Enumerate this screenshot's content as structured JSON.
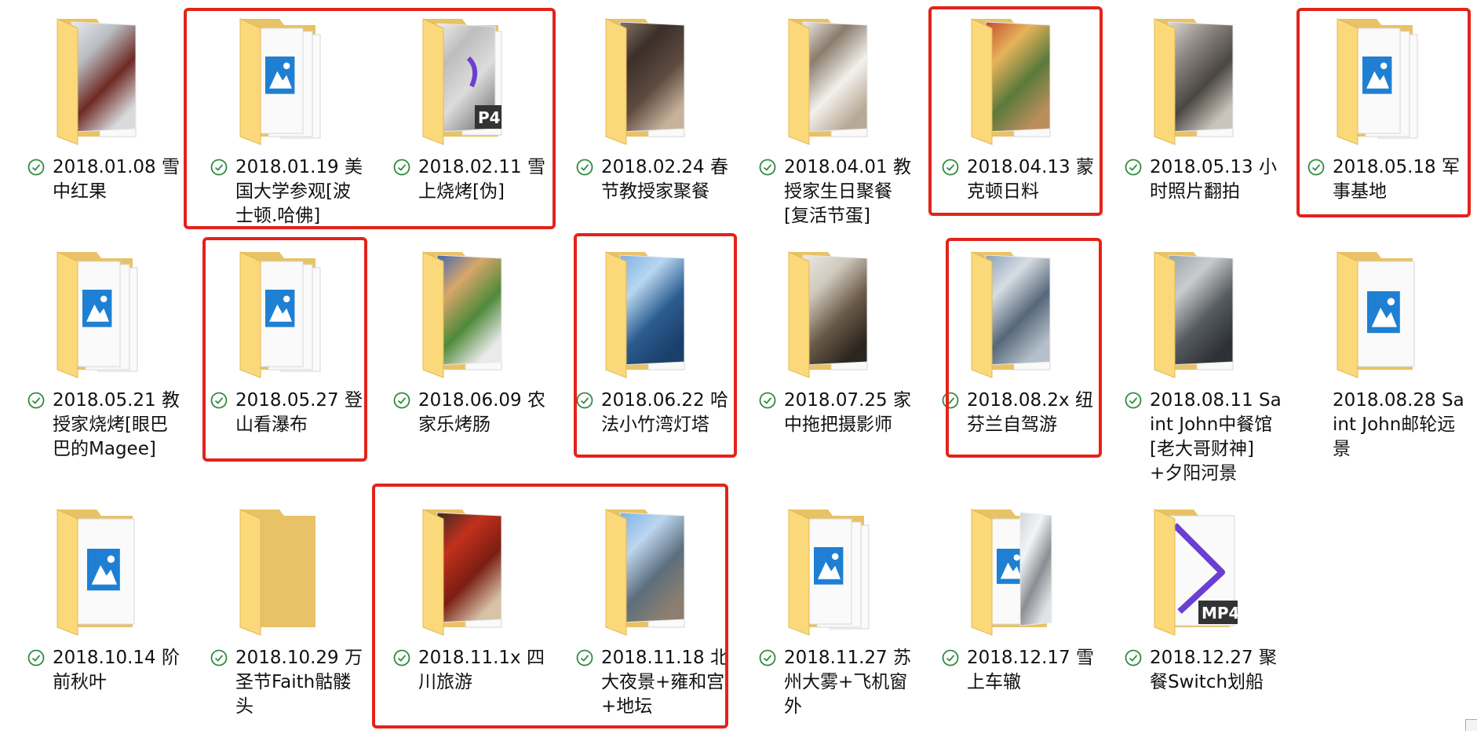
{
  "colors": {
    "folder_back": "#e8c266",
    "folder_front": "#fbd97b",
    "folder_edge": "#e2b955",
    "sync_check": "#2f8a3e",
    "highlight": "#e3231b",
    "placeholder_blue": "#1e7fd3"
  },
  "folders": [
    {
      "name": "2018.01.08 雪中红果",
      "preview": "snow-tree-photo",
      "synced": true
    },
    {
      "name": "2018.01.19 美国大学参观[波士顿.哈佛]",
      "preview": "image-placeholder-stack",
      "synced": true
    },
    {
      "name": "2018.02.11 雪上烧烤[伪]",
      "preview": "photo-with-mp4-badge",
      "synced": true
    },
    {
      "name": "2018.02.24 春节教授家聚餐",
      "preview": "group-photo",
      "synced": true
    },
    {
      "name": "2018.04.01 教授家生日聚餐[复活节蛋]",
      "preview": "photo-prints",
      "synced": true
    },
    {
      "name": "2018.04.13 蒙克顿日料",
      "preview": "sushi-photo",
      "synced": true
    },
    {
      "name": "2018.05.13 小时照片翻拍",
      "preview": "old-photo",
      "synced": true
    },
    {
      "name": "2018.05.18 军事基地",
      "preview": "image-placeholder-stack",
      "synced": true
    },
    {
      "name": "2018.05.21 教授家烧烤[眼巴巴的Magee]",
      "preview": "image-placeholder-stack",
      "synced": true
    },
    {
      "name": "2018.05.27 登山看瀑布",
      "preview": "image-placeholder-stack",
      "synced": true
    },
    {
      "name": "2018.06.09 农家乐烤肠",
      "preview": "food-plate-photo",
      "synced": true
    },
    {
      "name": "2018.06.22 哈法小竹湾灯塔",
      "preview": "sea-photo",
      "synced": true
    },
    {
      "name": "2018.07.25 家中拖把摄影师",
      "preview": "room-photo",
      "synced": true
    },
    {
      "name": "2018.08.2x 纽芬兰自驾游",
      "preview": "sky-photo",
      "synced": true
    },
    {
      "name": "2018.08.11 Saint John中餐馆[老大哥财神]+夕阳河景",
      "preview": "sunset-photo",
      "synced": true
    },
    {
      "name": "2018.08.28 Saint John邮轮远景",
      "preview": "image-placeholder-single",
      "synced": false
    },
    {
      "name": "2018.10.14 阶前秋叶",
      "preview": "image-placeholder-single",
      "synced": true
    },
    {
      "name": "2018.10.29 万圣节Faith骷髅头",
      "preview": "empty-folder",
      "synced": true
    },
    {
      "name": "2018.11.1x 四川旅游",
      "preview": "spicy-dish-photo",
      "synced": true
    },
    {
      "name": "2018.11.18 北大夜景+雍和宫+地坛",
      "preview": "square-photo",
      "synced": true
    },
    {
      "name": "2018.11.27 苏州大雾+飞机窗外",
      "preview": "image-placeholder-stack",
      "synced": true
    },
    {
      "name": "2018.12.17 雪上车辙",
      "preview": "placeholder-and-snow-photo",
      "synced": true
    },
    {
      "name": "2018.12.27 聚餐Switch划船",
      "preview": "mp4-video",
      "synced": true
    }
  ],
  "mp4_badge": "MP4",
  "mp4_badge_partial": "P4"
}
